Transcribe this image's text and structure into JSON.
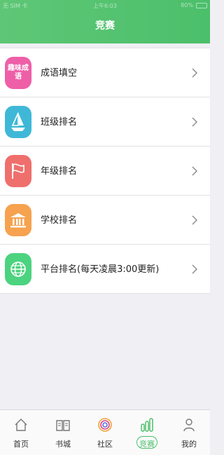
{
  "statusbar": {
    "carrier": "无 SIM 卡",
    "time": "上午6:03",
    "battery": "80%"
  },
  "header": {
    "title": "竞赛"
  },
  "rows": [
    {
      "icon": "idiom-icon",
      "icon_text": "趣味成语",
      "label": "成语填空",
      "color": "#ee5fa8"
    },
    {
      "icon": "sailboat-icon",
      "label": "班级排名",
      "color": "#3fb8d8"
    },
    {
      "icon": "flag-icon",
      "label": "年级排名",
      "color": "#ef6f6d"
    },
    {
      "icon": "school-icon",
      "label": "学校排名",
      "color": "#f6a24e"
    },
    {
      "icon": "globe-icon",
      "label": "平台排名(每天凌晨3:00更新)",
      "color": "#4cd37f"
    }
  ],
  "tabs": [
    {
      "icon": "home-icon",
      "label": "首页",
      "active": false
    },
    {
      "icon": "book-icon",
      "label": "书城",
      "active": false
    },
    {
      "icon": "community-icon",
      "label": "社区",
      "active": false
    },
    {
      "icon": "chart-icon",
      "label": "竞赛",
      "active": true
    },
    {
      "icon": "person-icon",
      "label": "我的",
      "active": false
    }
  ],
  "accent": "#4cbf6b"
}
